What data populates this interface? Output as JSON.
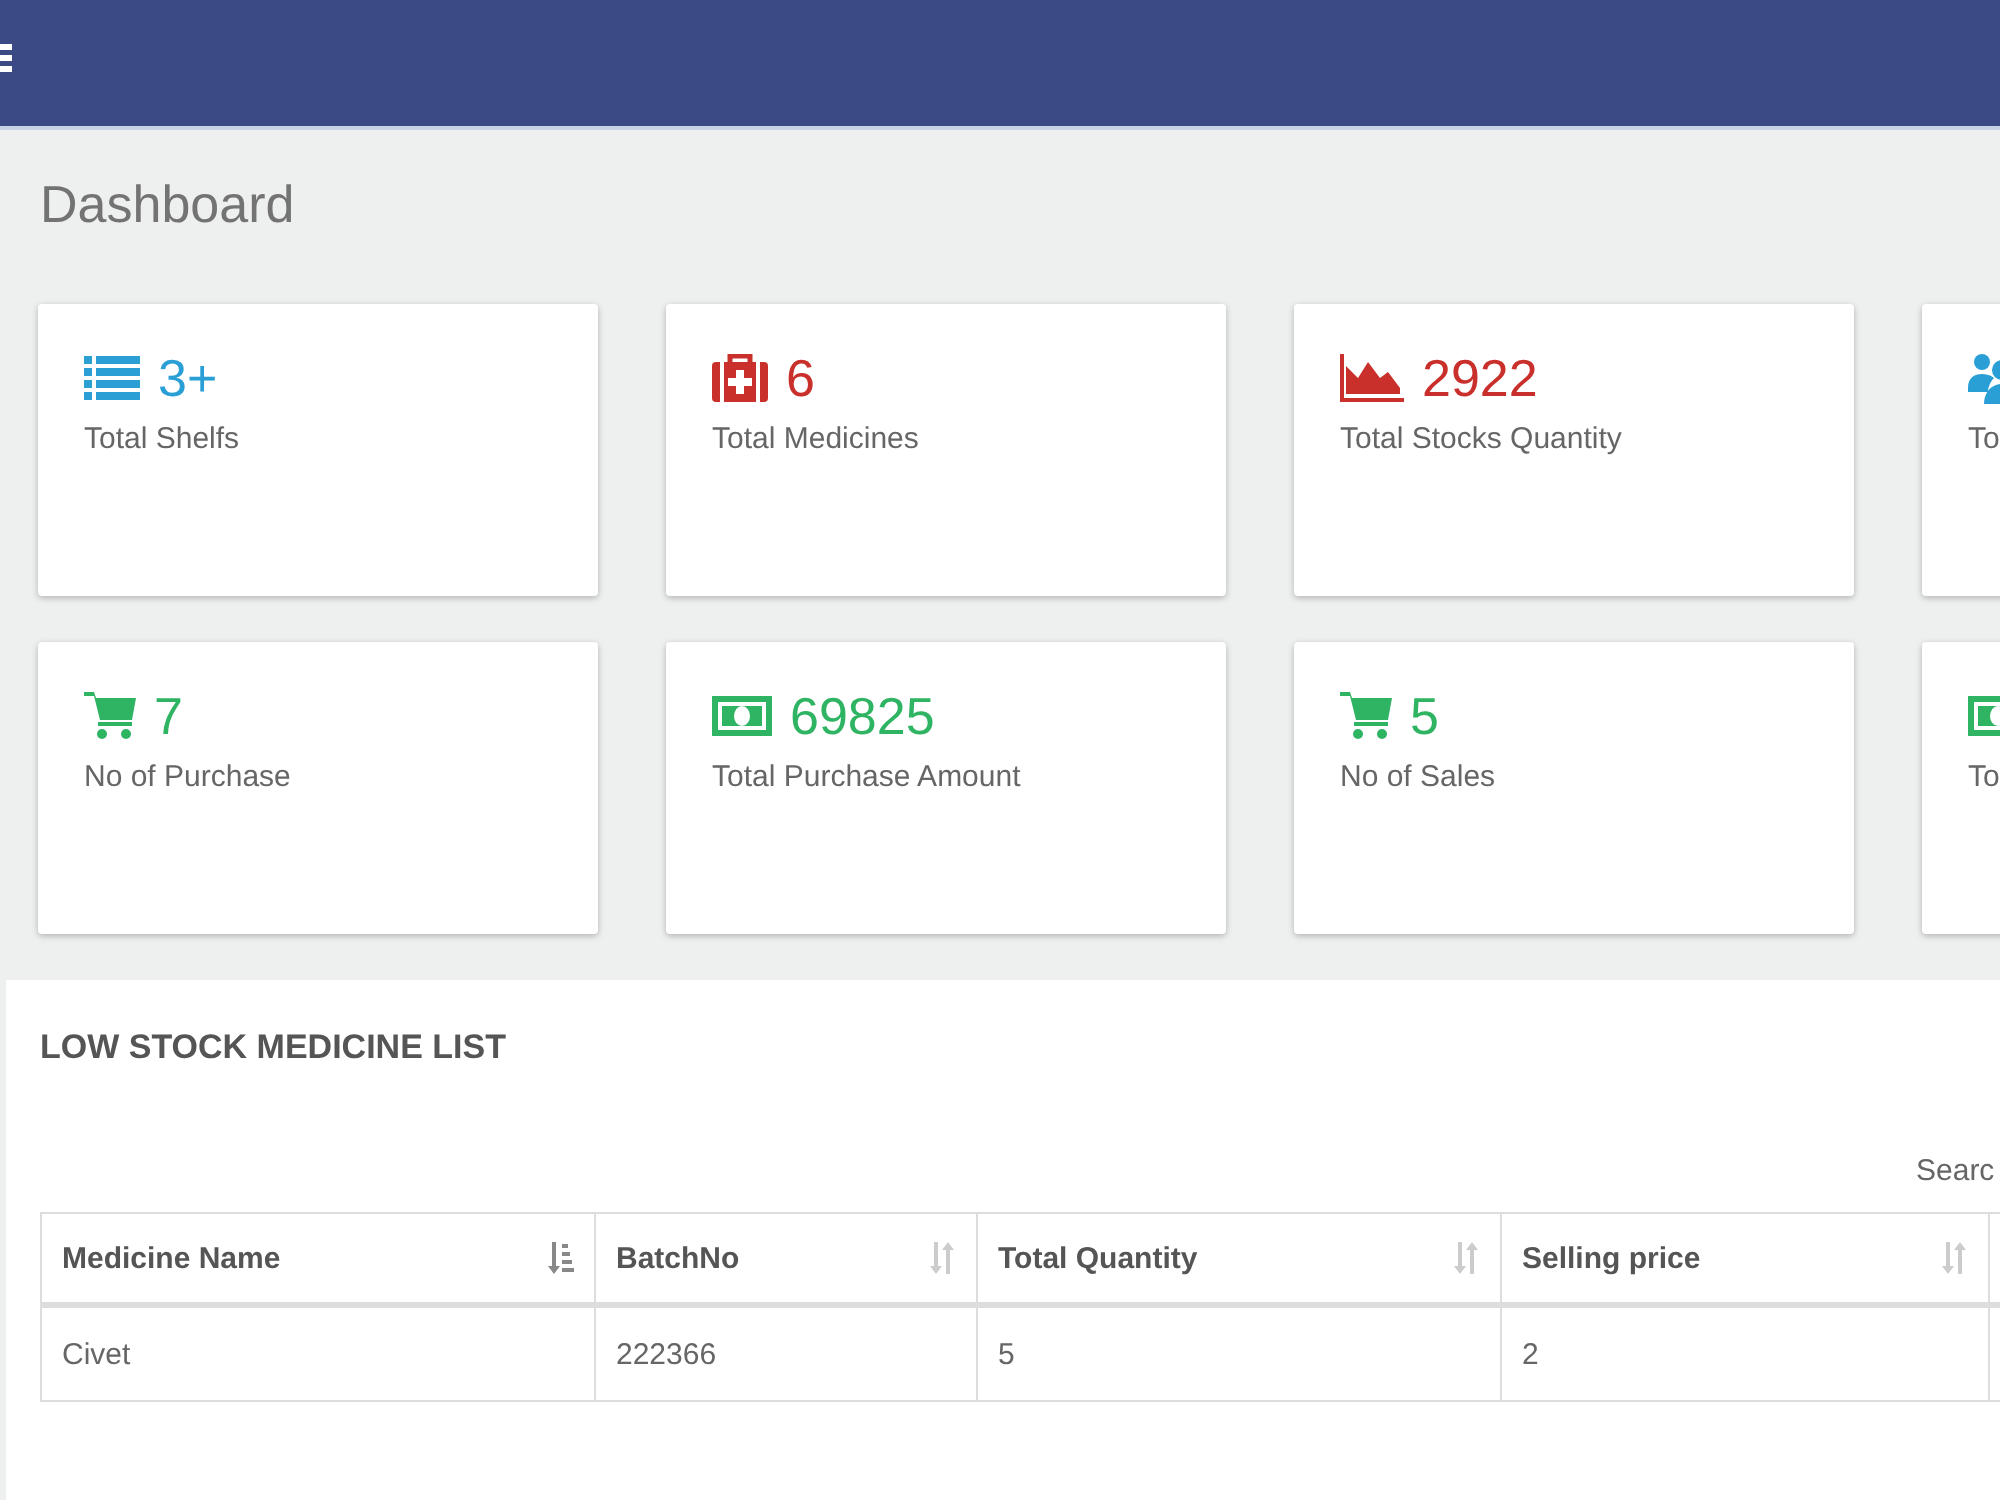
{
  "page_title": "Dashboard",
  "stat_cards": [
    {
      "kind": "list",
      "value": "3+",
      "label": "Total Shelfs",
      "color": "#2a9fd6"
    },
    {
      "kind": "medkit",
      "value": "6",
      "label": "Total Medicines",
      "color": "#c9302c"
    },
    {
      "kind": "chart",
      "value": "2922",
      "label": "Total Stocks Quantity",
      "color": "#c9302c"
    },
    {
      "kind": "users",
      "label": "To",
      "color": "#2a9fd6"
    },
    {
      "kind": "cart",
      "value": "7",
      "label": "No of Purchase",
      "color": "#2fb464"
    },
    {
      "kind": "money",
      "value": "69825",
      "label": "Total Purchase Amount",
      "color": "#2fb464"
    },
    {
      "kind": "cart",
      "value": "5",
      "label": "No of Sales",
      "color": "#2fb464"
    },
    {
      "kind": "money",
      "label": "To",
      "color": "#2fb464"
    }
  ],
  "low_stock": {
    "title": "LOW STOCK MEDICINE LIST",
    "search_label": "Searc",
    "columns": [
      {
        "label": "Medicine Name",
        "sorted": true
      },
      {
        "label": "BatchNo",
        "sorted": false
      },
      {
        "label": "Total Quantity",
        "sorted": false
      },
      {
        "label": "Selling price",
        "sorted": false
      }
    ],
    "rows": [
      [
        "Civet",
        "222366",
        "5",
        "2"
      ]
    ]
  }
}
